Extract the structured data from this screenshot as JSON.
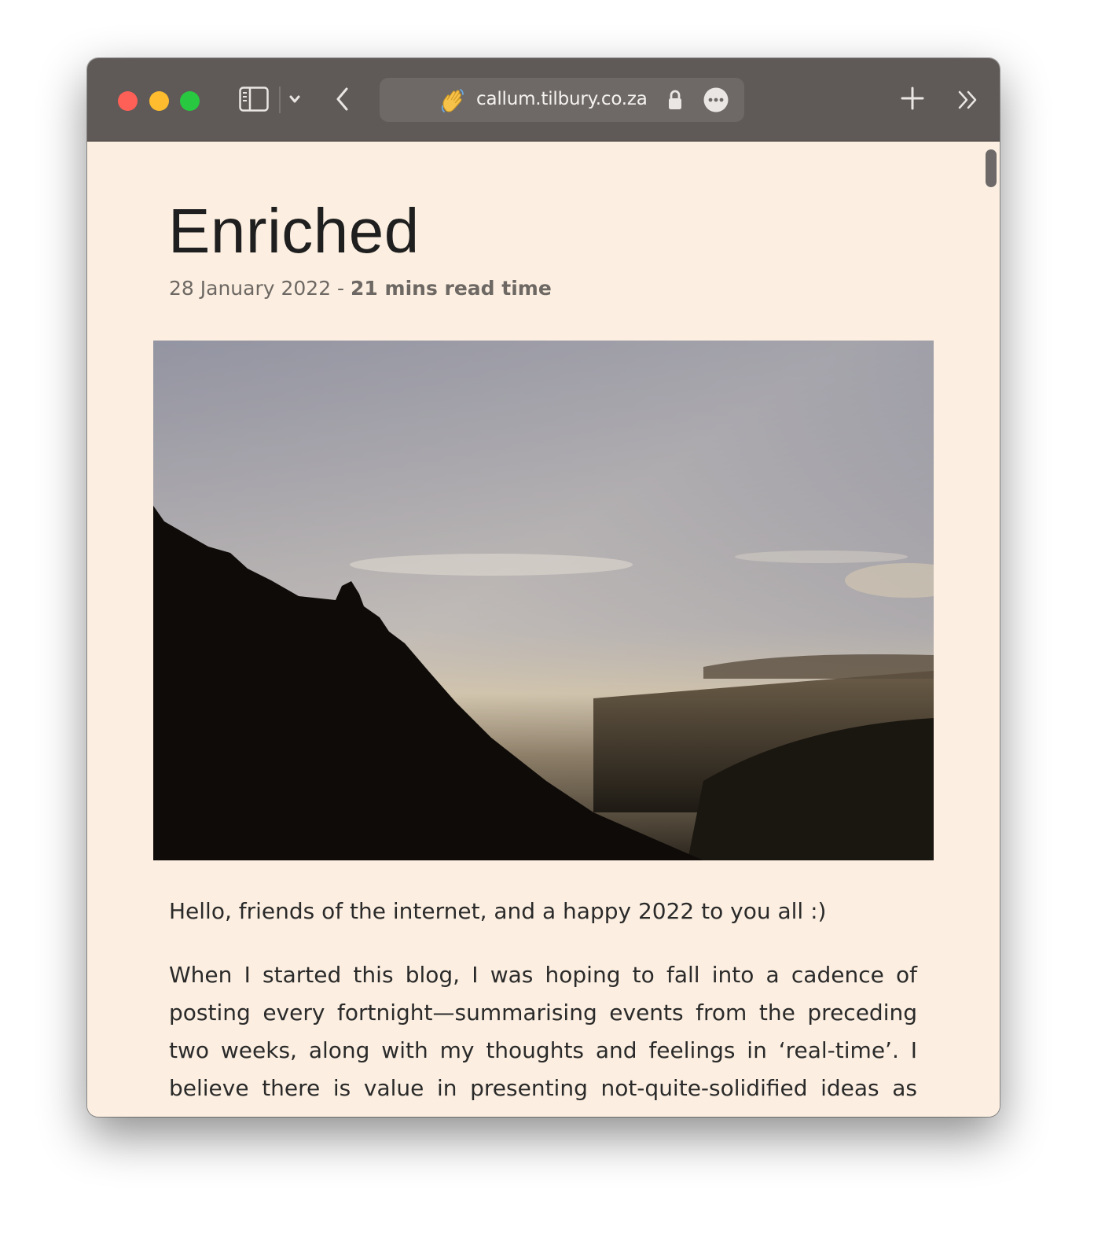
{
  "browser": {
    "url": "callum.tilbury.co.za",
    "site_emoji": "👋",
    "colors": {
      "toolbar": "#5f5a57",
      "close": "#fe5f57",
      "minimize": "#febc2e",
      "zoom": "#28c840"
    },
    "icons": [
      "sidebar-icon",
      "chevron-down-icon",
      "back-icon",
      "waving-hand-icon",
      "lock-icon",
      "more-icon",
      "plus-icon",
      "overflow-icon"
    ]
  },
  "article": {
    "title": "Enriched",
    "date": "28 January 2022",
    "separator": " - ",
    "read_time": "21 mins read time",
    "paragraphs": [
      "Hello, friends of the internet, and a happy 2022 to you all :)",
      "When I started this blog, I was hoping to fall into a cadence of posting every fortnight—summarising events from the preceding two weeks, along with my thoughts and feelings in ‘real-time’. I believe there is value in presenting not-quite-solidified ideas as they are, with nicks and scratches and an honest account of the process."
    ],
    "background_color": "#fcefe1"
  }
}
